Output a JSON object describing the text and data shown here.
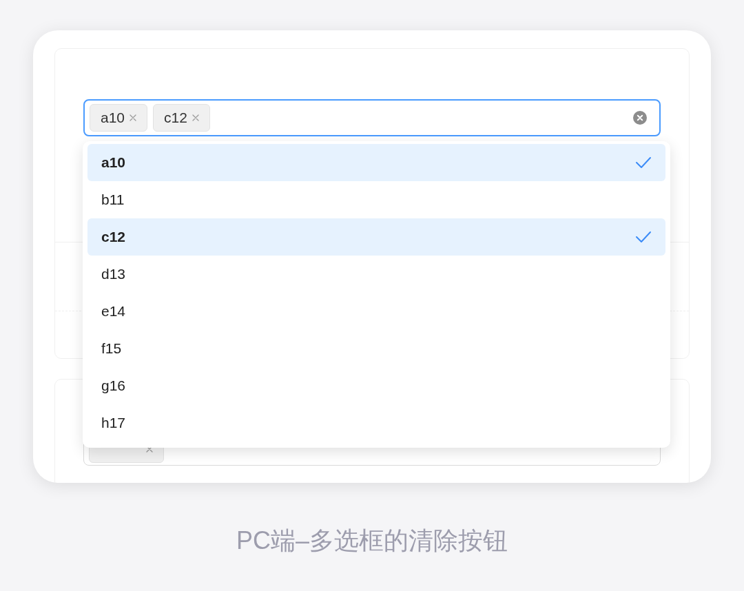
{
  "select": {
    "focused": true,
    "tags": [
      {
        "label": "a10"
      },
      {
        "label": "c12"
      }
    ]
  },
  "options": [
    {
      "label": "a10",
      "selected": true
    },
    {
      "label": "b11",
      "selected": false
    },
    {
      "label": "c12",
      "selected": true
    },
    {
      "label": "d13",
      "selected": false
    },
    {
      "label": "e14",
      "selected": false
    },
    {
      "label": "f15",
      "selected": false
    },
    {
      "label": "g16",
      "selected": false
    },
    {
      "label": "h17",
      "selected": false
    }
  ],
  "second_select": {
    "tags": [
      {
        "removable": true
      }
    ]
  },
  "caption": "PC端–多选框的清除按钮"
}
